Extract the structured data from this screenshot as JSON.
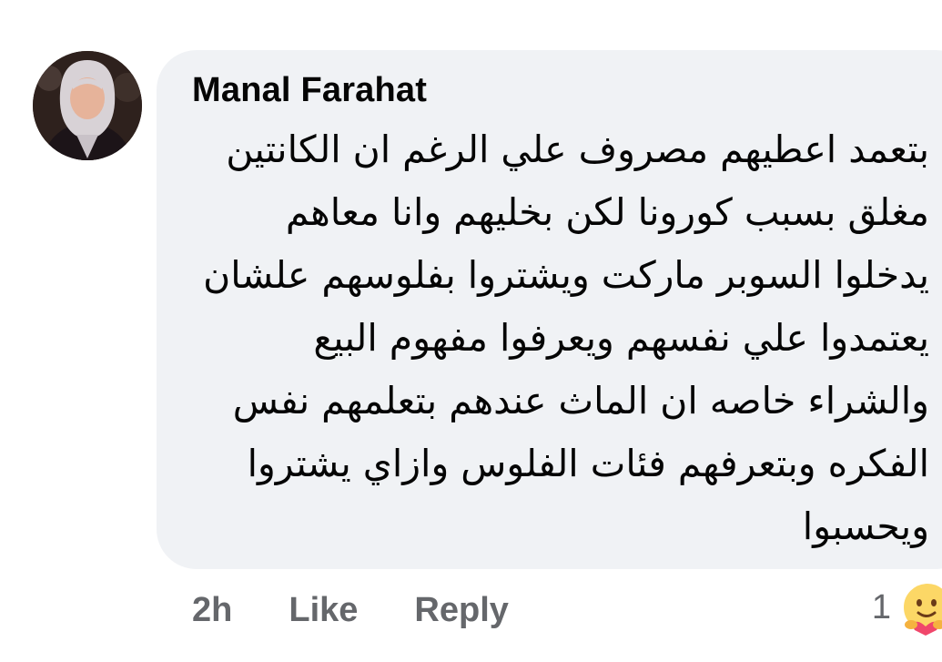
{
  "comment": {
    "author": "Manal Farahat",
    "text": "بتعمد اعطيهم مصروف علي الرغم ان الكانتين\nمغلق بسبب كورونا لكن بخليهم وانا معاهم\nيدخلوا السوبر ماركت ويشتروا بفلوسهم علشان\nيعتمدوا علي نفسهم ويعرفوا مفهوم البيع\nوالشراء خاصه ان الماث عندهم بتعلمهم نفس\nالفكره وبتعرفهم فئات الفلوس وازاي يشتروا\nويحسبوا"
  },
  "actions": {
    "timestamp": "2h",
    "like_label": "Like",
    "reply_label": "Reply"
  },
  "reactions": {
    "count": "1",
    "icon": "care-reaction-icon"
  },
  "colors": {
    "bubble": "#f0f2f5",
    "text": "#050505",
    "secondary": "#65676b"
  }
}
